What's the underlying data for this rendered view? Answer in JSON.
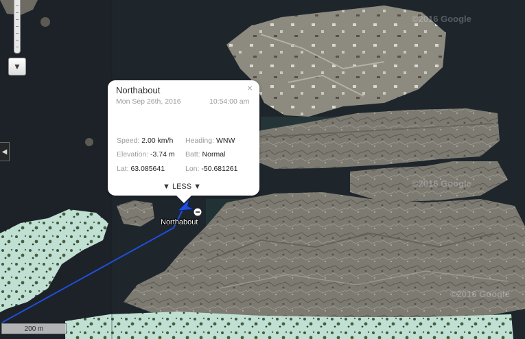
{
  "map": {
    "attribution": "©2016 Google",
    "track_color": "#1e4fd8",
    "scale_label": "200 m"
  },
  "popup": {
    "title": "Northabout",
    "close": "×",
    "date": "Mon Sep 26th, 2016",
    "time": "10:54:00 am",
    "speed_label": "Speed:",
    "speed_value": "2.00 km/h",
    "heading_label": "Heading:",
    "heading_value": "WNW",
    "elevation_label": "Elevation:",
    "elevation_value": "-3.74 m",
    "batt_label": "Batt:",
    "batt_value": "Normal",
    "lat_label": "Lat:",
    "lat_value": "63.085641",
    "lon_label": "Lon:",
    "lon_value": "-50.681261",
    "less_label": "▼ LESS ▼"
  },
  "marker": {
    "label": "Northabout",
    "icon": "boat-heading-arrow-icon",
    "badge_icon": "minus-circle-icon"
  },
  "controls": {
    "zoom_out_icon": "▼",
    "side_tab_icon": "◀"
  }
}
